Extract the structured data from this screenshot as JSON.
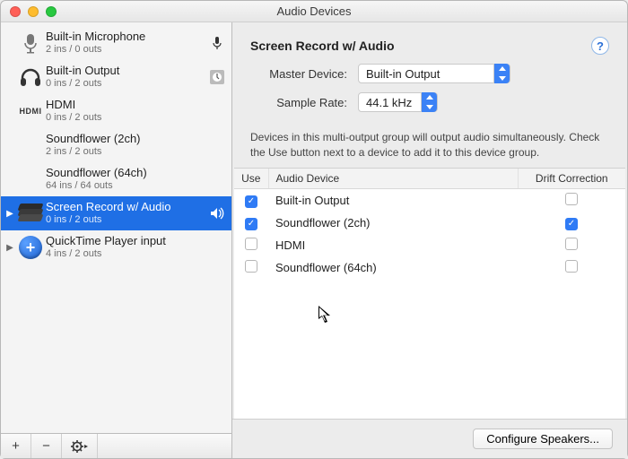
{
  "window": {
    "title": "Audio Devices"
  },
  "sidebar": {
    "devices": [
      {
        "name": "Built-in Microphone",
        "sub": "2 ins / 0 outs"
      },
      {
        "name": "Built-in Output",
        "sub": "0 ins / 2 outs"
      },
      {
        "name": "HDMI",
        "sub": "0 ins / 2 outs"
      },
      {
        "name": "Soundflower (2ch)",
        "sub": "2 ins / 2 outs"
      },
      {
        "name": "Soundflower (64ch)",
        "sub": "64 ins / 64 outs"
      },
      {
        "name": "Screen Record w/ Audio",
        "sub": "0 ins / 2 outs"
      },
      {
        "name": "QuickTime Player input",
        "sub": "4 ins / 2 outs"
      }
    ]
  },
  "main": {
    "title": "Screen Record w/ Audio",
    "master_label": "Master Device:",
    "master_value": "Built-in Output",
    "rate_label": "Sample Rate:",
    "rate_value": "44.1 kHz",
    "hint": "Devices in this multi-output group will output audio simultaneously. Check the Use button next to a device to add it to this device group.",
    "headers": {
      "use": "Use",
      "device": "Audio Device",
      "drift": "Drift Correction"
    },
    "rows": [
      {
        "use": true,
        "device": "Built-in Output",
        "drift": false
      },
      {
        "use": true,
        "device": "Soundflower (2ch)",
        "drift": true
      },
      {
        "use": false,
        "device": "HDMI",
        "drift": false
      },
      {
        "use": false,
        "device": "Soundflower (64ch)",
        "drift": false
      }
    ],
    "configure_btn": "Configure Speakers..."
  },
  "icons": {
    "hdmi": "HDMI"
  }
}
